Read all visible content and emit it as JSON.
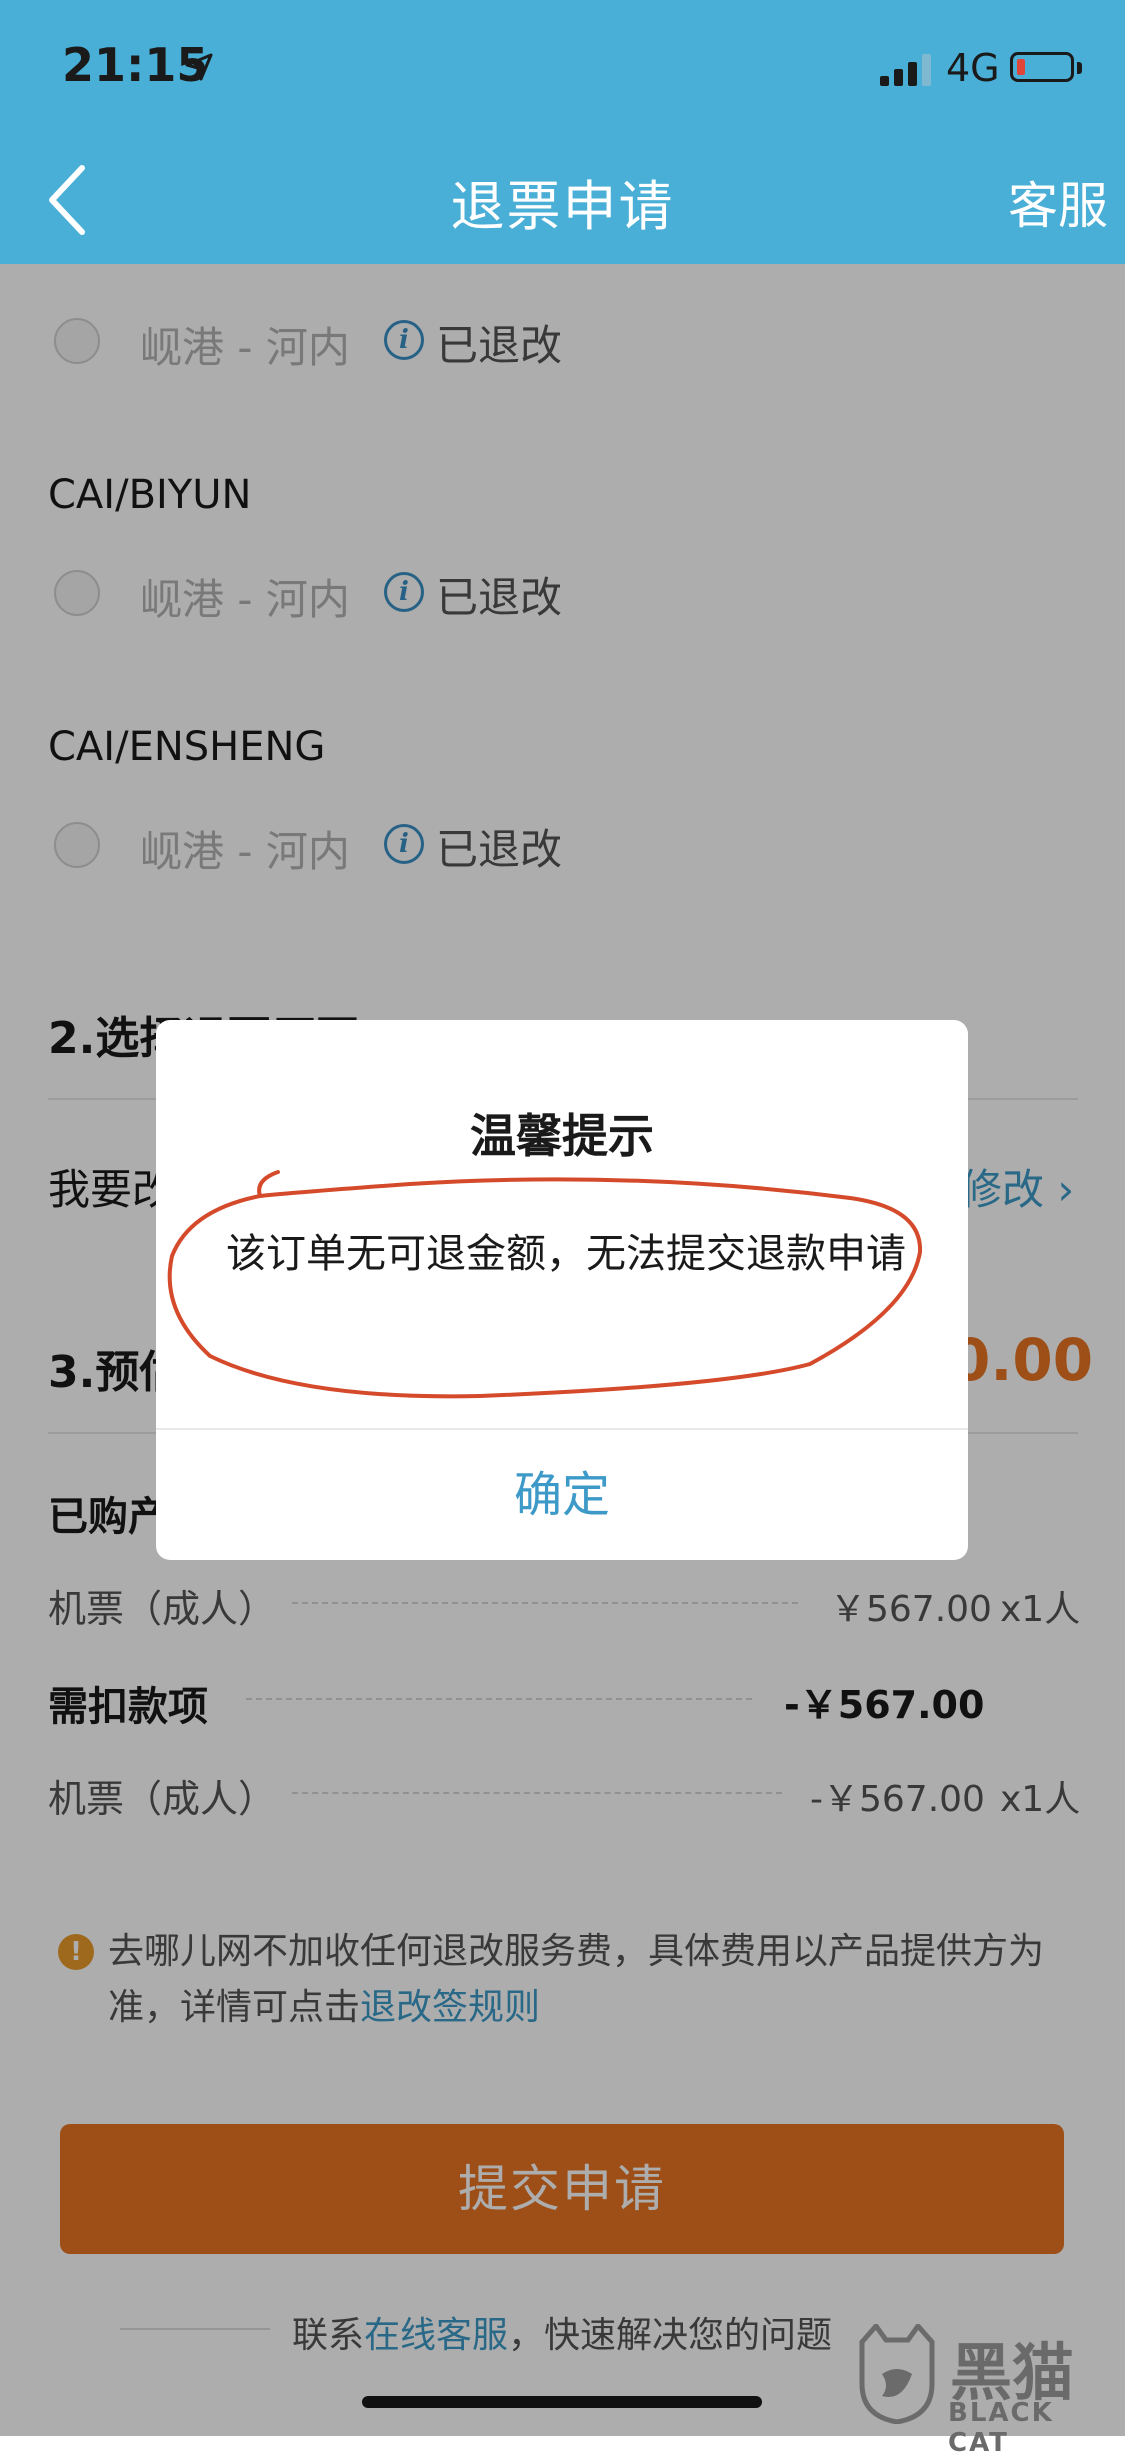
{
  "status_bar": {
    "time": "21:15",
    "network": "4G"
  },
  "nav": {
    "title": "退票申请",
    "service": "客服"
  },
  "segments": [
    {
      "route": "岘港 - 河内",
      "status": "已退改"
    },
    {
      "passenger": "CAI/BIYUN",
      "route": "岘港 - 河内",
      "status": "已退改"
    },
    {
      "passenger": "CAI/ENSHENG",
      "route": "岘港 - 河内",
      "status": "已退改"
    }
  ],
  "section2": {
    "title_visible": "2.选择退票原因",
    "reason_visible": "我要改",
    "reason_action": "修改 ›"
  },
  "section3": {
    "title_visible": "3.预估",
    "amount_visible": "0.00"
  },
  "purchased": {
    "label_visible": "已购产"
  },
  "rows": [
    {
      "label": "机票（成人）",
      "amount": "￥567.00",
      "qty": "x1人"
    },
    {
      "label": "需扣款项",
      "amount": "-￥567.00"
    },
    {
      "label": "机票（成人）",
      "amount": "-￥567.00",
      "qty": "x1人"
    }
  ],
  "notice": {
    "text": "去哪儿网不加收任何退改服务费，具体费用以产品提供方为准，详情可点击",
    "link": "退改签规则"
  },
  "submit_button": "提交申请",
  "footer": {
    "pre": "联系",
    "link": "在线客服",
    "post": "，快速解决您的问题"
  },
  "watermark": {
    "cn": "黑猫",
    "en": "BLACK CAT"
  },
  "dialog": {
    "title": "温馨提示",
    "message": "该订单无可退金额，无法提交退款申请",
    "confirm": "确定"
  },
  "colors": {
    "nav_bg": "#4aafd6",
    "accent_orange": "#e97524",
    "link_blue": "#3d9ac8",
    "annotation_red": "#d44a2a"
  }
}
